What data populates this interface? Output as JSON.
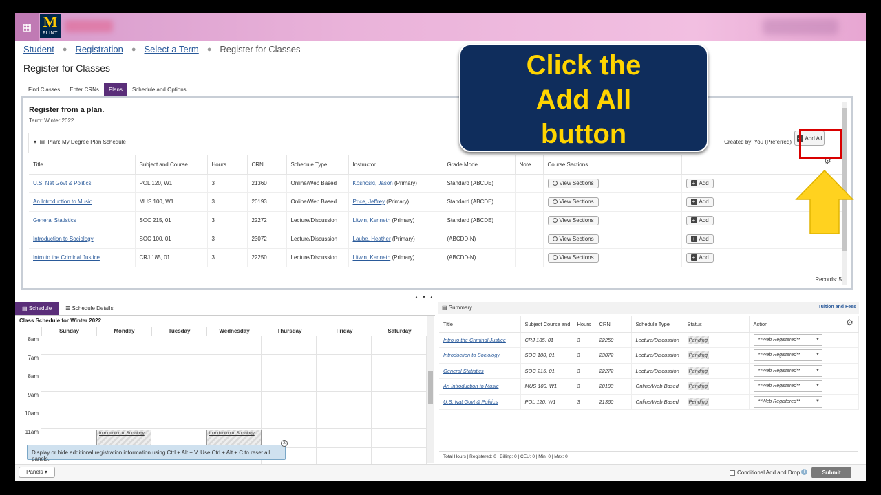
{
  "header": {
    "logo_letter": "M",
    "logo_sub": "FLINT"
  },
  "breadcrumb": [
    "Student",
    "Registration",
    "Select a Term",
    "Register for Classes"
  ],
  "page_title": "Register for Classes",
  "tabs": [
    "Find Classes",
    "Enter CRNs",
    "Plans",
    "Schedule and Options"
  ],
  "plan_panel": {
    "title": "Register from a plan.",
    "term": "Term: Winter 2022",
    "plan_label": "Plan: My Degree Plan Schedule",
    "created_by": "Created by: You (Preferred)",
    "add_all_label": "Add All",
    "records": "Records: 5",
    "columns": [
      "Title",
      "Subject and Course",
      "Hours",
      "CRN",
      "Schedule Type",
      "Instructor",
      "Grade Mode",
      "Note",
      "Course Sections",
      ""
    ],
    "view_sections_label": "View Sections",
    "add_label": "Add",
    "rows": [
      {
        "title": "U.S. Nat Govt & Politics",
        "subject": "POL 120, W1",
        "hours": "3",
        "crn": "21360",
        "type": "Online/Web Based",
        "instructor": "Kosnoski, Jason",
        "role": "(Primary)",
        "grade": "Standard (ABCDE)"
      },
      {
        "title": "An Introduction to Music",
        "subject": "MUS 100, W1",
        "hours": "3",
        "crn": "20193",
        "type": "Online/Web Based",
        "instructor": "Price, Jeffrey",
        "role": "(Primary)",
        "grade": "Standard (ABCDE)"
      },
      {
        "title": "General Statistics",
        "subject": "SOC 215, 01",
        "hours": "3",
        "crn": "22272",
        "type": "Lecture/Discussion",
        "instructor": "Litwin, Kenneth",
        "role": "(Primary)",
        "grade": "Standard (ABCDE)"
      },
      {
        "title": "Introduction to Sociology",
        "subject": "SOC 100, 01",
        "hours": "3",
        "crn": "23072",
        "type": "Lecture/Discussion",
        "instructor": "Laube, Heather",
        "role": "(Primary)",
        "grade": "(ABCDD-N)"
      },
      {
        "title": "Intro to the Criminal Justice",
        "subject": "CRJ 185, 01",
        "hours": "3",
        "crn": "22250",
        "type": "Lecture/Discussion",
        "instructor": "Litwin, Kenneth",
        "role": "(Primary)",
        "grade": "(ABCDD-N)"
      }
    ]
  },
  "callout": {
    "lines": [
      "Click the",
      "Add All",
      "button"
    ],
    "text_color": "#ffd400",
    "bg_color": "#0f2d5c"
  },
  "schedule": {
    "tabs": [
      "Schedule",
      "Schedule Details"
    ],
    "title": "Class Schedule for Winter 2022",
    "days": [
      "Sunday",
      "Monday",
      "Tuesday",
      "Wednesday",
      "Thursday",
      "Friday",
      "Saturday"
    ],
    "hours": [
      "8am",
      "7am",
      "8am",
      "9am",
      "10am",
      "11am"
    ],
    "event_label": "Introduction to Sociology",
    "tooltip": "Display or hide additional registration information using Ctrl + Alt + V. Use Ctrl + Alt + C to reset all panels."
  },
  "summary": {
    "title": "Summary",
    "tuition_link": "Tuition and Fees",
    "columns": [
      "Title",
      "Subject Course and",
      "Hours",
      "CRN",
      "Schedule Type",
      "Status",
      "Action"
    ],
    "rows": [
      {
        "title": "Intro to the Criminal Justice",
        "subject": "CRJ 185, 01",
        "hours": "3",
        "crn": "22250",
        "type": "Lecture/Discussion",
        "status": "Pending",
        "action": "**Web Registered**"
      },
      {
        "title": "Introduction to Sociology",
        "subject": "SOC 100, 01",
        "hours": "3",
        "crn": "23072",
        "type": "Lecture/Discussion",
        "status": "Pending",
        "action": "**Web Registered**"
      },
      {
        "title": "General Statistics",
        "subject": "SOC 215, 01",
        "hours": "3",
        "crn": "22272",
        "type": "Lecture/Discussion",
        "status": "Pending",
        "action": "**Web Registered**"
      },
      {
        "title": "An Introduction to Music",
        "subject": "MUS 100, W1",
        "hours": "3",
        "crn": "20193",
        "type": "Online/Web Based",
        "status": "Pending",
        "action": "**Web Registered**"
      },
      {
        "title": "U.S. Nat Govt & Politics",
        "subject": "POL 120, W1",
        "hours": "3",
        "crn": "21360",
        "type": "Online/Web Based",
        "status": "Pending",
        "action": "**Web Registered**"
      }
    ],
    "footer": "Total Hours | Registered: 0 | Billing: 0 | CEU: 0 | Min: 0 | Max: 0"
  },
  "bottom": {
    "panels_label": "Panels",
    "conditional_label": "Conditional Add and Drop",
    "submit_label": "Submit"
  },
  "colors": {
    "accent_purple": "#5a2e79",
    "highlight_red": "#d90000",
    "arrow_yellow": "#ffd21f",
    "link_blue": "#2a5a9a"
  }
}
